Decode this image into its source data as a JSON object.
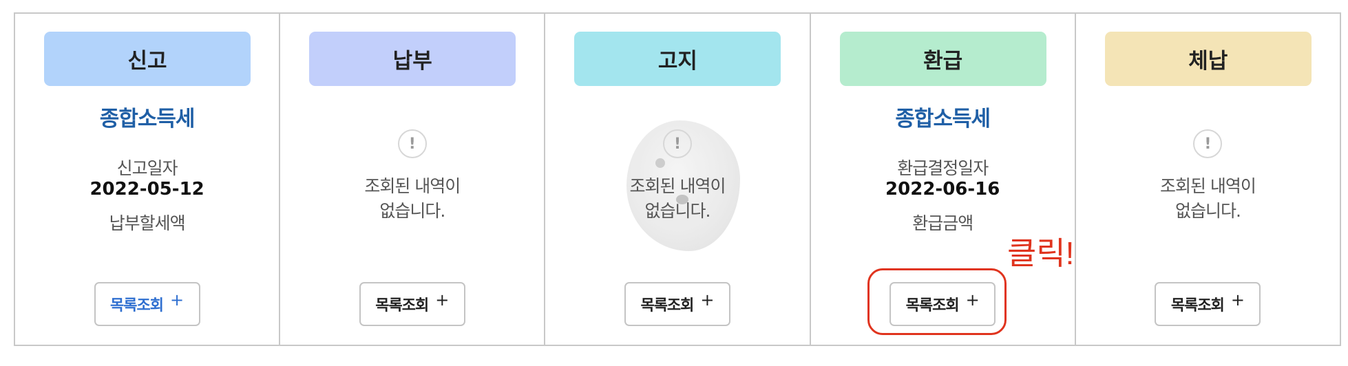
{
  "columns": [
    {
      "category": "신고",
      "category_color": "#b2d3fb",
      "tax_name": "종합소득세",
      "date_label": "신고일자",
      "date": "2022-05-12",
      "amount_label": "납부할세액",
      "button": "목록조회",
      "button_plus": "+"
    },
    {
      "category": "납부",
      "category_color": "#c2cffb",
      "alert_icon": "!",
      "empty_line1": "조회된 내역이",
      "empty_line2": "없습니다.",
      "button": "목록조회",
      "button_plus": "+"
    },
    {
      "category": "고지",
      "category_color": "#a3e5ee",
      "alert_icon": "!",
      "empty_line1": "조회된 내역이",
      "empty_line2": "없습니다.",
      "button": "목록조회",
      "button_plus": "+"
    },
    {
      "category": "환급",
      "category_color": "#b5ecce",
      "tax_name": "종합소득세",
      "date_label": "환급결정일자",
      "date": "2022-06-16",
      "amount_label": "환급금액",
      "button": "목록조회",
      "button_plus": "+"
    },
    {
      "category": "체납",
      "category_color": "#f4e4b6",
      "alert_icon": "!",
      "empty_line1": "조회된 내역이",
      "empty_line2": "없습니다.",
      "button": "목록조회",
      "button_plus": "+"
    }
  ],
  "annotation": {
    "click_text": "클릭!",
    "color": "#e0341e"
  }
}
